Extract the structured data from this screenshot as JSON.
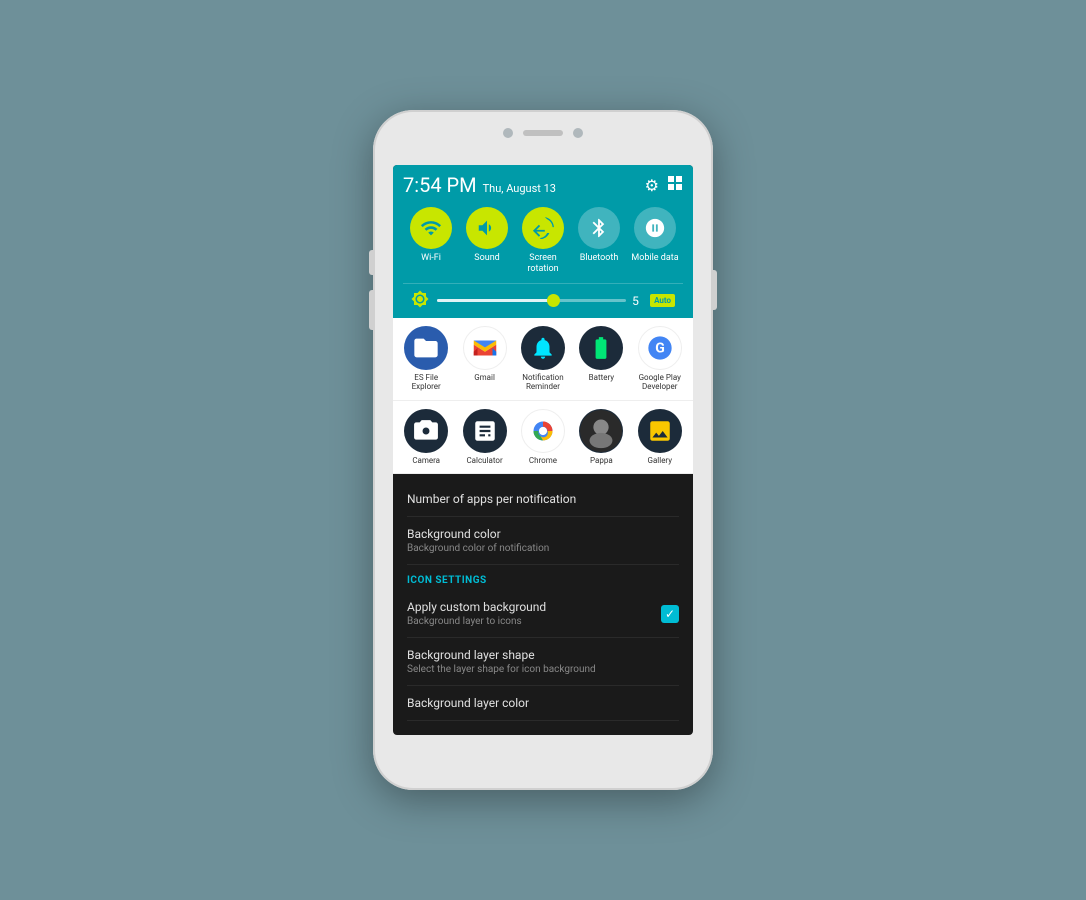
{
  "phone": {
    "status_bar": {
      "time": "7:54 PM",
      "date": "Thu, August 13",
      "settings_icon": "⚙",
      "grid_icon": "⊞"
    },
    "quick_toggles": [
      {
        "id": "wifi",
        "label": "Wi-Fi",
        "active": true,
        "icon": "wifi"
      },
      {
        "id": "sound",
        "label": "Sound",
        "active": true,
        "icon": "sound"
      },
      {
        "id": "screen_rotation",
        "label": "Screen rotation",
        "active": true,
        "icon": "rotation"
      },
      {
        "id": "bluetooth",
        "label": "Bluetooth",
        "active": false,
        "icon": "bluetooth"
      },
      {
        "id": "mobile_data",
        "label": "Mobile data",
        "active": false,
        "icon": "mobile_data"
      }
    ],
    "brightness": {
      "value": "5",
      "auto_label": "Auto",
      "fill_percent": 60
    },
    "app_rows": [
      {
        "apps": [
          {
            "name": "ES File Explorer",
            "icon_type": "es"
          },
          {
            "name": "Gmail",
            "icon_type": "gmail"
          },
          {
            "name": "Notification\nReminder",
            "icon_type": "notif"
          },
          {
            "name": "Battery",
            "icon_type": "battery"
          },
          {
            "name": "Google Play Developer",
            "icon_type": "gpdev"
          }
        ]
      },
      {
        "apps": [
          {
            "name": "Camera",
            "icon_type": "camera"
          },
          {
            "name": "Calculator",
            "icon_type": "calc"
          },
          {
            "name": "Chrome",
            "icon_type": "chrome"
          },
          {
            "name": "Pappa",
            "icon_type": "pappa"
          },
          {
            "name": "Gallery",
            "icon_type": "gallery"
          }
        ]
      }
    ],
    "settings": {
      "rows_before_section": [
        {
          "title": "Number of apps per notification",
          "subtitle": ""
        },
        {
          "title": "Background color",
          "subtitle": "Background color of notification"
        }
      ],
      "icon_settings_header": "ICON SETTINGS",
      "icon_rows": [
        {
          "title": "Apply custom background",
          "subtitle": "Background layer to icons",
          "has_checkbox": true,
          "checked": true
        },
        {
          "title": "Background layer shape",
          "subtitle": "Select the layer shape for icon background",
          "has_checkbox": false
        },
        {
          "title": "Background layer color",
          "subtitle": "",
          "has_checkbox": false
        }
      ]
    }
  }
}
